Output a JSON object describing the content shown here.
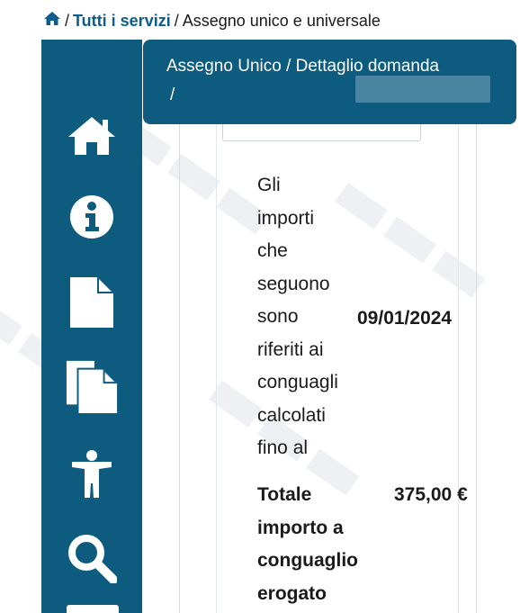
{
  "breadcrumb": {
    "services_link": "Tutti i servizi",
    "separator": "/",
    "current": "Assegno unico e universale"
  },
  "header": {
    "title": "Assegno Unico / Dettaglio domanda",
    "line2": "/"
  },
  "sidebar": {
    "icons": [
      "home-icon",
      "info-icon",
      "document-icon",
      "copy-documents-icon",
      "accessibility-icon",
      "search-icon"
    ]
  },
  "detail": {
    "rows": [
      {
        "label_lines": [
          "Gli",
          "importi",
          "che",
          "seguono",
          "sono",
          "riferiti ai",
          "conguagli",
          "calcolati",
          "fino al"
        ],
        "value": "09/01/2024"
      },
      {
        "label_lines": [
          "Totale",
          "importo a",
          "conguaglio",
          "erogato"
        ],
        "value": "375,00 €"
      }
    ]
  },
  "colors": {
    "brand_blue": "#0e5b80",
    "link_blue": "#0b5d8a"
  }
}
